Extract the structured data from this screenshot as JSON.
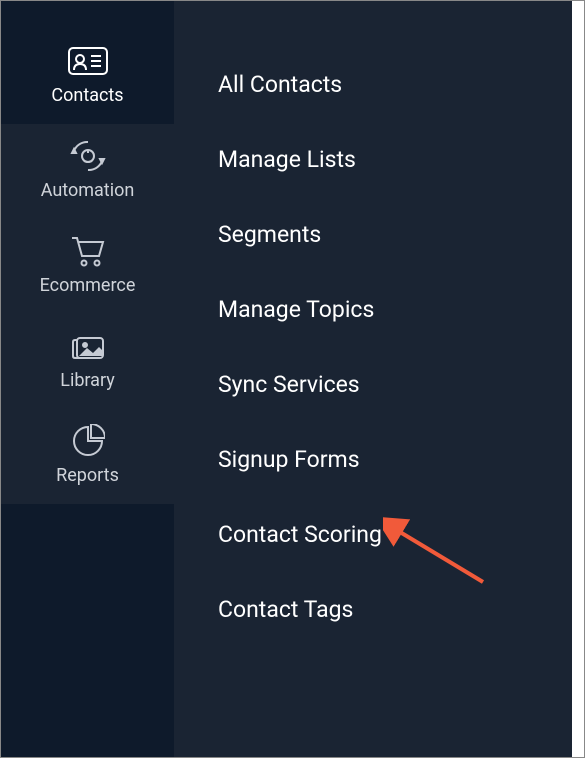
{
  "sidebar": {
    "items": [
      {
        "label": "Contacts",
        "active": true
      },
      {
        "label": "Automation",
        "active": false
      },
      {
        "label": "Ecommerce",
        "active": false
      },
      {
        "label": "Library",
        "active": false
      },
      {
        "label": "Reports",
        "active": false
      }
    ]
  },
  "submenu": {
    "items": [
      {
        "label": "All Contacts"
      },
      {
        "label": "Manage Lists"
      },
      {
        "label": "Segments"
      },
      {
        "label": "Manage Topics"
      },
      {
        "label": "Sync Services"
      },
      {
        "label": "Signup Forms"
      },
      {
        "label": "Contact Scoring"
      },
      {
        "label": "Contact Tags"
      }
    ]
  }
}
